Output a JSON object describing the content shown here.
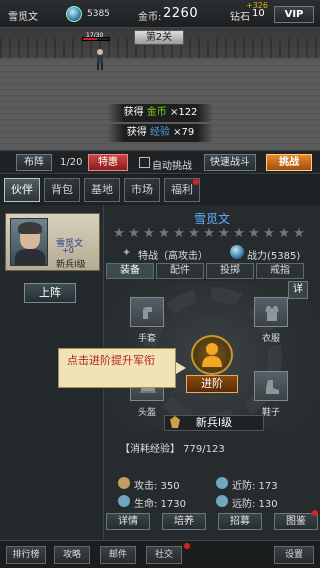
{
  "topbar": {
    "player_name": "雪觅文",
    "power_value": "5385",
    "gold_label": "金币:",
    "gold_value": "2260",
    "diamond_label": "钻石",
    "diamond_value": "10",
    "diamond_float": "+326",
    "vip_label": "VIP"
  },
  "scene": {
    "stage_label": "第2关",
    "hp_text": "17/30",
    "hp_fraction": 0.55,
    "rewards": [
      {
        "prefix": "获得",
        "item": "金币",
        "amount": "×122"
      },
      {
        "prefix": "获得",
        "item": "经验",
        "amount": "×79"
      }
    ]
  },
  "actionbar": {
    "formation_label": "布阵",
    "count_text": "1/20",
    "special_label": "特惠",
    "auto_challenge_label": "自动挑战",
    "quick_battle_label": "快速战斗",
    "challenge_label": "挑战"
  },
  "tabs": [
    "伙伴",
    "背包",
    "基地",
    "市场",
    "福利"
  ],
  "hero_card": {
    "name": "雪觅文",
    "plus": "+0",
    "rank": "新兵I级",
    "deploy_label": "上阵"
  },
  "detail": {
    "hero_name": "雪觅文",
    "trait": "特战（高攻击）",
    "power": "战力(5385)",
    "subtabs": [
      "装备",
      "配件",
      "投掷",
      "戒指"
    ],
    "detail_btn": "详",
    "slots": {
      "gloves": "手套",
      "clothes": "衣服",
      "helmet": "头盔",
      "shoes": "鞋子"
    },
    "advance_label": "进阶",
    "rank_label": "新兵I级",
    "exp_line": "【消耗经验】 779/123",
    "stats": {
      "attack": "攻击: 350",
      "near_def": "近防: 173",
      "hp": "生命: 1730",
      "far_def": "远防: 130"
    },
    "bottom_btns": [
      "详情",
      "培养",
      "招募",
      "图鉴"
    ]
  },
  "tooltip": "点击进阶提升军衔",
  "bottomnav": [
    "排行榜",
    "攻略",
    "邮件",
    "社交",
    "设置"
  ],
  "colors": {
    "accent_red": "#e02020",
    "highlight_green": "#7ed321",
    "hero_name_blue": "#5fb0ff",
    "challenge_orange": "#e68a2e"
  }
}
